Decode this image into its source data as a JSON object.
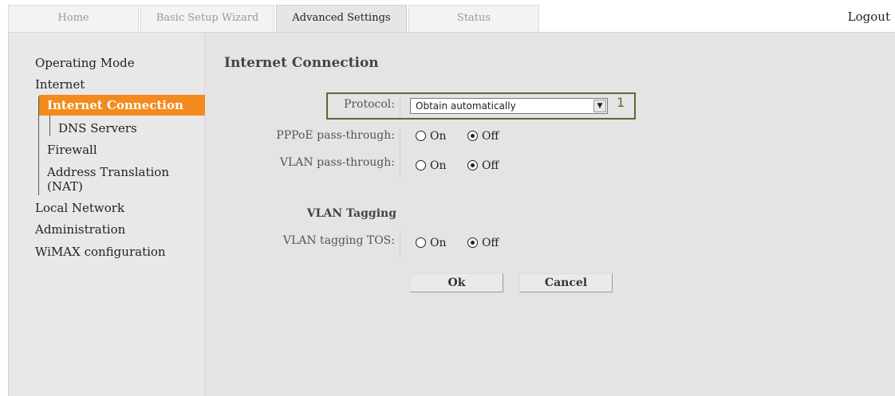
{
  "tabs": [
    {
      "label": "Home",
      "active": false
    },
    {
      "label": "Basic Setup Wizard",
      "active": false
    },
    {
      "label": "Advanced Settings",
      "active": true
    },
    {
      "label": "Status",
      "active": false
    }
  ],
  "logout_label": "Logout",
  "sidebar": {
    "items": {
      "operating_mode": "Operating Mode",
      "internet": "Internet",
      "internet_connection": "Internet Connection",
      "dns_servers": "DNS Servers",
      "firewall": "Firewall",
      "nat_line1": "Address Translation",
      "nat_line2": "(NAT)",
      "local_network": "Local Network",
      "administration": "Administration",
      "wimax": "WiMAX configuration"
    },
    "active_item": "Internet Connection"
  },
  "main": {
    "title": "Internet Connection",
    "protocol": {
      "label": "Protocol:",
      "selected": "Obtain automatically",
      "callout": "1"
    },
    "pppoe": {
      "label": "PPPoE pass-through:",
      "on": "On",
      "off": "Off",
      "value": "Off"
    },
    "vlan_pass": {
      "label": "VLAN pass-through:",
      "on": "On",
      "off": "Off",
      "value": "Off"
    },
    "vlan_tagging_heading": "VLAN Tagging",
    "vlan_tos": {
      "label": "VLAN tagging TOS:",
      "on": "On",
      "off": "Off",
      "value": "Off"
    },
    "ok_label": "Ok",
    "cancel_label": "Cancel"
  },
  "colors": {
    "active_nav": "#f28a1d",
    "callout_border": "#5a6b2e"
  }
}
